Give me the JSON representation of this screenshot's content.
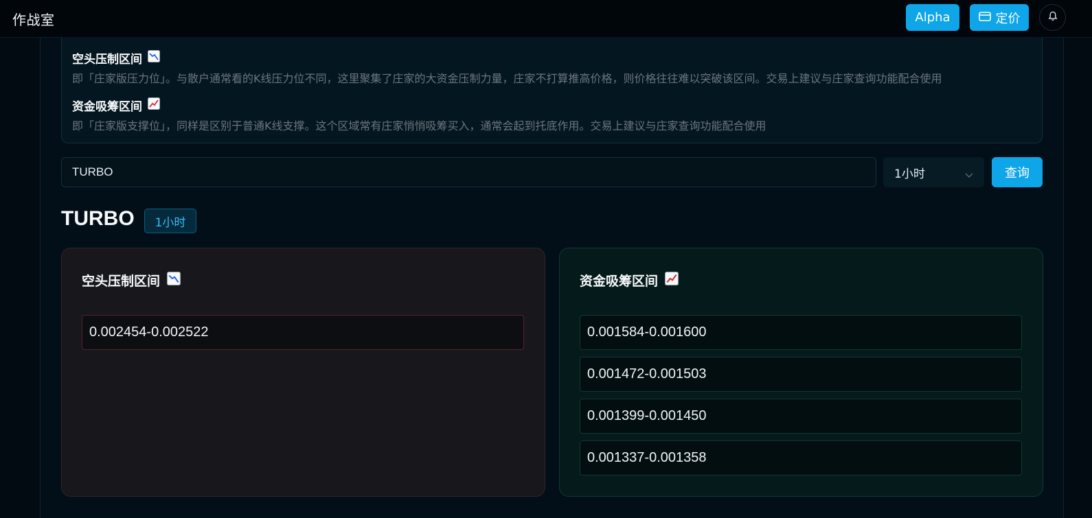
{
  "app": {
    "title": "作战室"
  },
  "header": {
    "alpha_label": "Alpha",
    "pricing_label": "定价"
  },
  "info": {
    "short": {
      "title": "空头压制区间",
      "emoji": "📉",
      "desc": "即「庄家版压力位」。与散户通常看的K线压力位不同，这里聚集了庄家的大资金压制力量，庄家不打算推高价格，则价格往往难以突破该区间。交易上建议与庄家查询功能配合使用"
    },
    "long": {
      "title": "资金吸筹区间",
      "emoji": "📈",
      "desc": "即「庄家版支撑位」，同样是区别于普通K线支撑。这个区域常有庄家悄悄吸筹买入，通常会起到托底作用。交易上建议与庄家查询功能配合使用"
    }
  },
  "search": {
    "value": "TURBO",
    "interval": "1小时",
    "query_label": "查询"
  },
  "result": {
    "symbol": "TURBO",
    "interval": "1小时",
    "short_card": {
      "title": "空头压制区间",
      "emoji": "📉",
      "ranges": [
        "0.002454-0.002522"
      ]
    },
    "long_card": {
      "title": "资金吸筹区间",
      "emoji": "📈",
      "ranges": [
        "0.001584-0.001600",
        "0.001472-0.001503",
        "0.001399-0.001450",
        "0.001337-0.001358"
      ]
    }
  },
  "colors": {
    "accent": "#0ea5e9",
    "background": "#020b12",
    "short_border": "#5a2228",
    "long_border": "#123832"
  }
}
